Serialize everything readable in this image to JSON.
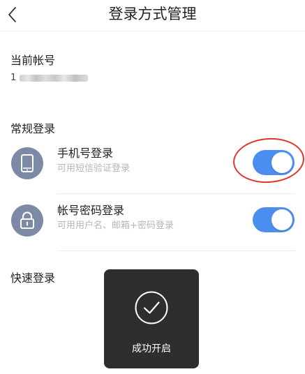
{
  "header": {
    "title": "登录方式管理",
    "back_icon": "chevron-left-icon"
  },
  "account": {
    "label": "当前帐号",
    "number_prefix": "1",
    "number_visible": "1"
  },
  "regular": {
    "label": "常规登录",
    "items": [
      {
        "title": "手机号登录",
        "subtitle": "可用短信验证登录",
        "icon": "phone-icon",
        "enabled": true
      },
      {
        "title": "帐号密码登录",
        "subtitle": "可用用户名、邮箱+密码登录",
        "icon": "lock-icon",
        "enabled": true
      }
    ]
  },
  "quick": {
    "label": "快速登录"
  },
  "toast": {
    "icon": "checkmark-circle-icon",
    "text": "成功开启"
  },
  "colors": {
    "toggle_on": "#4a8ef0",
    "icon_bg": "#7d8aa6",
    "annotation": "#e0342c"
  }
}
